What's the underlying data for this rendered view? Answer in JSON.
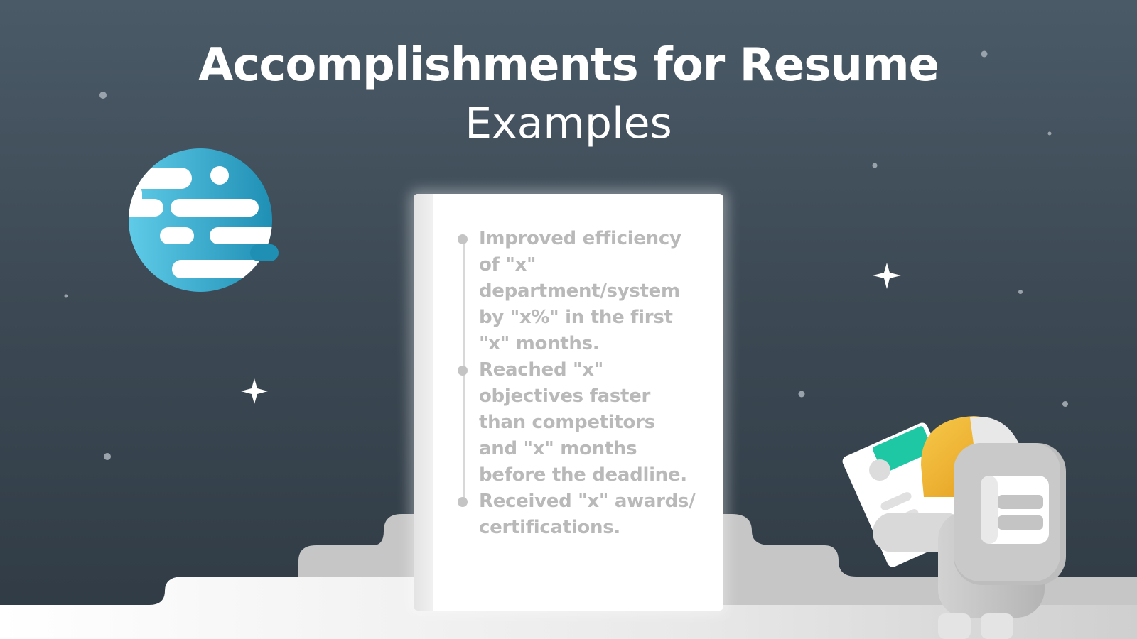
{
  "heading": {
    "title": "Accomplishments for Resume",
    "subtitle": "Examples"
  },
  "document": {
    "items": [
      "Improved efficiency of \"x\" department/system by \"x%\" in the first \"x\" months.",
      "Reached \"x\" objectives faster than competitors and \"x\" months before the deadline.",
      "Received \"x\" awards/ certifications."
    ]
  },
  "colors": {
    "sky_top": "#4a5a67",
    "sky_bottom": "#2f3a44",
    "planet": "#2fa6c9",
    "astronaut_visor": "#f2b233",
    "card_accent": "#1ec8a5",
    "text_muted": "#b9b9b9"
  },
  "icons": [
    "planet-icon",
    "sparkle-star-icon",
    "astronaut-icon",
    "resume-card-icon"
  ]
}
